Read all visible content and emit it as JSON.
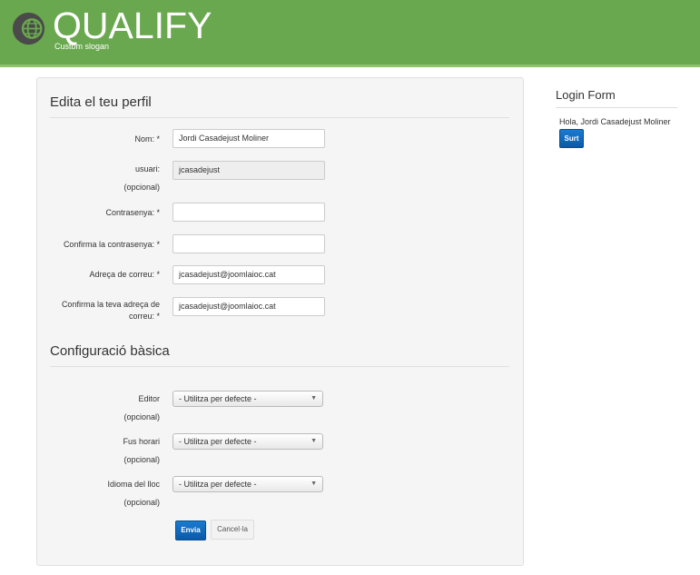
{
  "header": {
    "logo_text": "QUALIFY",
    "slogan": "Custom slogan",
    "logo_icon": "globe-icon",
    "bg_color": "#6aa84f"
  },
  "profile": {
    "section_title": "Edita el teu perfil",
    "fields": {
      "name": {
        "label": "Nom: *",
        "value": "Jordi Casadejust Moliner"
      },
      "username": {
        "label": "usuari:",
        "optional": "(opcional)",
        "value": "jcasadejust"
      },
      "password": {
        "label": "Contrasenya: *",
        "value": ""
      },
      "password_confirm": {
        "label": "Confirma la contrasenya: *",
        "value": ""
      },
      "email": {
        "label": "Adreça de correu: *",
        "value": "jcasadejust@joomlaioc.cat"
      },
      "email_confirm": {
        "label_line1": "Confirma la teva adreça de",
        "label_line2": "correu: *",
        "value": "jcasadejust@joomlaioc.cat"
      }
    }
  },
  "basic": {
    "section_title": "Configuració bàsica",
    "editor": {
      "label": "Editor",
      "optional": "(opcional)",
      "value": "- Utilitza per defecte -"
    },
    "timezone": {
      "label": "Fus horari",
      "optional": "(opcional)",
      "value": "- Utilitza per defecte -"
    },
    "language": {
      "label": "Idioma del lloc",
      "optional": "(opcional)",
      "value": "- Utilitza per defecte -"
    }
  },
  "actions": {
    "submit_label": "Envia",
    "cancel_label": "Cancel·la",
    "primary_color": "#0b5aa8"
  },
  "sidebar": {
    "title": "Login Form",
    "greeting": "Hola, Jordi Casadejust Moliner",
    "logout_label": "Surt"
  }
}
